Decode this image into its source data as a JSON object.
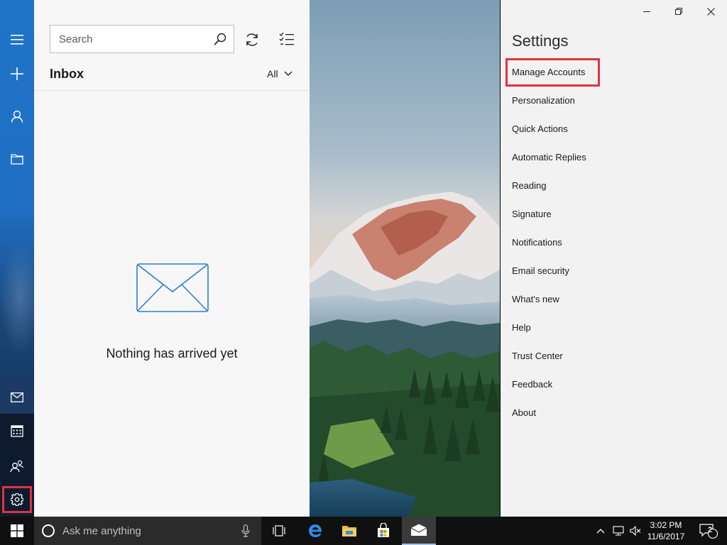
{
  "nav_rail": {
    "items": [
      {
        "name": "hamburger-icon"
      },
      {
        "name": "new-mail-icon"
      },
      {
        "name": "accounts-icon"
      },
      {
        "name": "folders-icon"
      }
    ],
    "bottom_items": [
      {
        "name": "mail-icon",
        "active": true
      },
      {
        "name": "calendar-icon"
      },
      {
        "name": "people-icon"
      },
      {
        "name": "settings-icon",
        "highlighted": true
      }
    ]
  },
  "list_pane": {
    "search_placeholder": "Search",
    "folder_title": "Inbox",
    "filter_label": "All",
    "empty_message": "Nothing has arrived yet"
  },
  "settings": {
    "title": "Settings",
    "highlighted_item": "Manage Accounts",
    "items": [
      "Manage Accounts",
      "Personalization",
      "Quick Actions",
      "Automatic Replies",
      "Reading",
      "Signature",
      "Notifications",
      "Email security",
      "What's new",
      "Help",
      "Trust Center",
      "Feedback",
      "About"
    ]
  },
  "taskbar": {
    "search_placeholder": "Ask me anything",
    "clock_time": "3:02 PM",
    "clock_date": "11/6/2017",
    "notification_count": "2"
  },
  "colors": {
    "accent": "#1f74c8",
    "highlight": "#e2323a",
    "mail_icon_blue": "#2b7cd3"
  }
}
